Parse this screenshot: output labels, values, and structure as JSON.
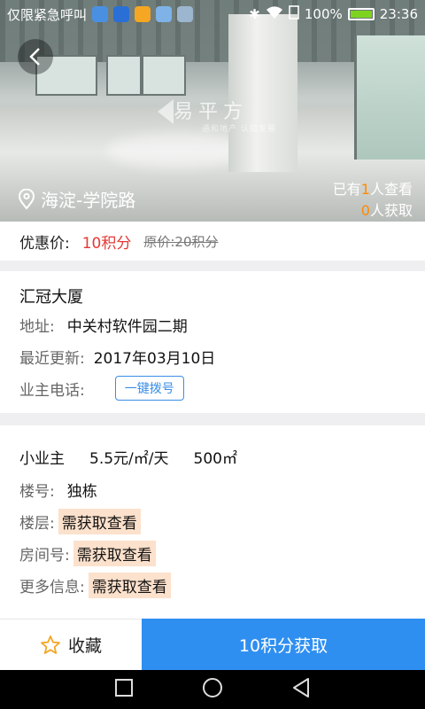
{
  "status_bar": {
    "carrier": "仅限紧急呼叫",
    "battery": "100%",
    "time": "23:36"
  },
  "hero": {
    "location": "海淀-学院路",
    "stats_prefix_1": "已有",
    "viewers": "1",
    "stats_suffix_1": "人查看",
    "obtained": "0",
    "stats_suffix_2": "人获取",
    "watermark": "易平方",
    "watermark_sub": "通和地产 认知发展"
  },
  "price": {
    "label": "优惠价:",
    "value": "10积分",
    "original": "原价:20积分"
  },
  "building": {
    "name": "汇冠大厦",
    "address_label": "地址:",
    "address": "中关村软件园二期",
    "updated_label": "最近更新:",
    "updated": "2017年03月10日",
    "phone_label": "业主电话:",
    "dial_button": "一键拨号"
  },
  "detail": {
    "owner_type": "小业主",
    "price_per_day": "5.5元/㎡/天",
    "area": "500㎡",
    "building_no_label": "楼号:",
    "building_no": "独栋",
    "floor_label": "楼层:",
    "floor": "需获取查看",
    "room_label": "房间号:",
    "room": "需获取查看",
    "more_label": "更多信息:",
    "more": "需获取查看"
  },
  "footer": {
    "favorite": "收藏",
    "obtain": "10积分获取"
  },
  "colors": {
    "accent_blue": "#2f8ff0",
    "price_red": "#e53935",
    "highlight_orange": "#ff8a00",
    "tag_bg": "#fce1cc"
  }
}
